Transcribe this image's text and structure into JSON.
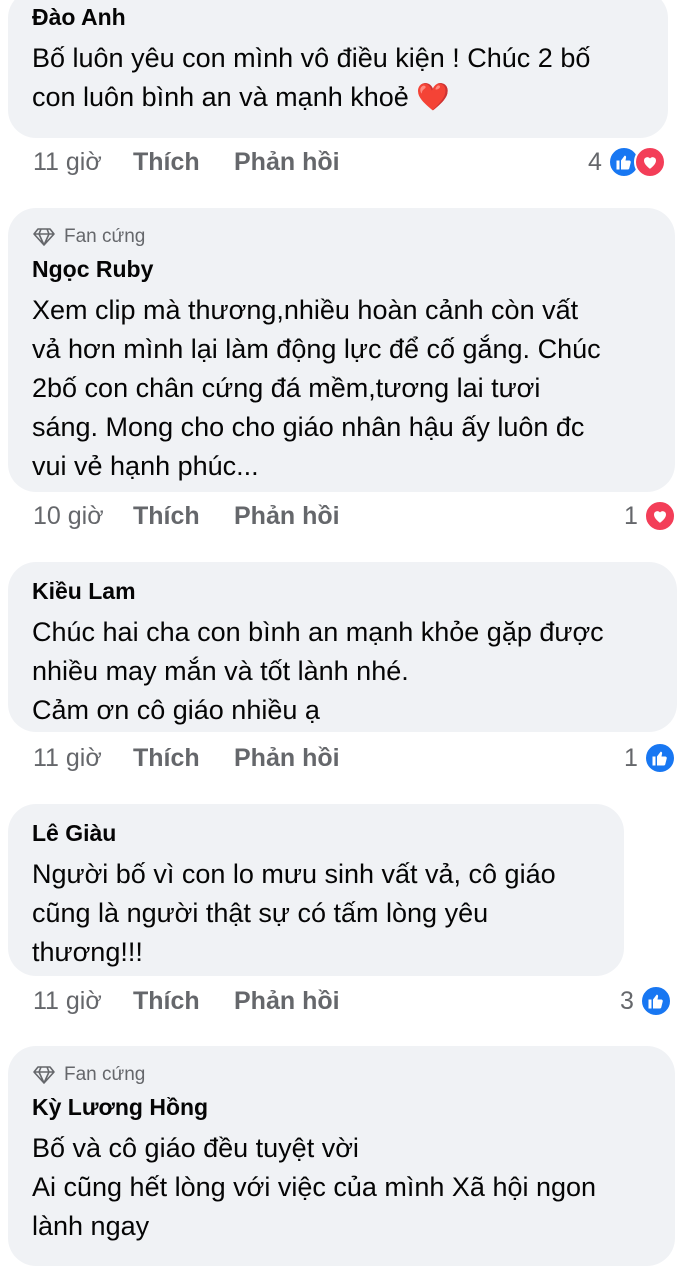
{
  "comments": [
    {
      "name": "Đào Anh",
      "text": "Bố luôn yêu con mình vô điều kiện ! Chúc 2 bố\ncon luôn bình an và mạnh khoẻ",
      "emoji": "❤️",
      "time": "11 giờ",
      "like_label": "Thích",
      "reply_label": "Phản hồi",
      "reaction_count": "4",
      "reactions": [
        "like",
        "love"
      ]
    },
    {
      "badge": "Fan cứng",
      "name": "Ngọc Ruby",
      "text": "Xem clip mà thương,nhiều hoàn cảnh còn vất\nvả hơn mình lại làm động lực để cố gắng. Chúc\n2bố con chân cứng đá mềm,tương lai tươi\nsáng. Mong cho cho giáo nhân hậu ấy luôn đc\nvui vẻ hạnh phúc...",
      "time": "10 giờ",
      "like_label": "Thích",
      "reply_label": "Phản hồi",
      "reaction_count": "1",
      "reactions": [
        "love"
      ]
    },
    {
      "name": "Kiều Lam",
      "text": "Chúc hai cha con bình an mạnh khỏe gặp được\nnhiều may mắn và tốt lành nhé.\nCảm ơn cô giáo nhiều ạ",
      "time": "11 giờ",
      "like_label": "Thích",
      "reply_label": "Phản hồi",
      "reaction_count": "1",
      "reactions": [
        "like"
      ]
    },
    {
      "name": "Lê Giàu",
      "text": "Người bố vì con lo mưu sinh vất vả, cô giáo\ncũng là người thật sự có tấm lòng yêu\nthương!!!",
      "time": "11 giờ",
      "like_label": "Thích",
      "reply_label": "Phản hồi",
      "reaction_count": "3",
      "reactions": [
        "like"
      ]
    },
    {
      "badge": "Fan cứng",
      "name": "Kỳ Lương Hồng",
      "text": "Bố và cô giáo đều tuyệt vời\nAi cũng hết lòng với việc của mình Xã hội ngon\nlành ngay"
    }
  ],
  "colors": {
    "bubble": "#f0f2f5",
    "meta": "#65676b",
    "like": "#1877f2",
    "love": "#f33e58"
  }
}
